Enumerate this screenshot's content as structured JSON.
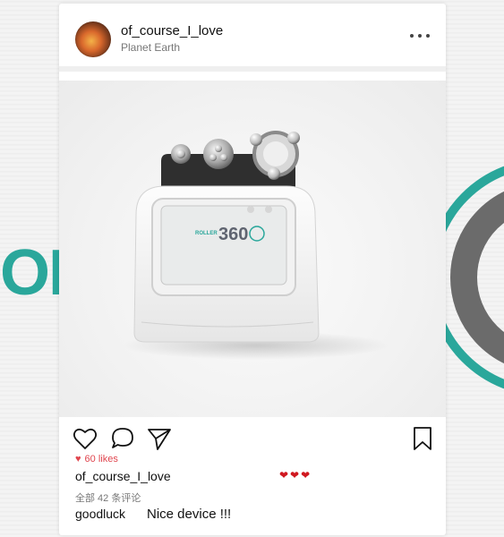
{
  "post": {
    "username": "of_course_I_love",
    "location": "Planet Earth",
    "likes": "60 likes",
    "caption_user": "of_course_I_love",
    "caption_hearts": "❤❤❤",
    "comments_count": "全部 42 条评论",
    "comment": {
      "user": "goodluck",
      "text": "Nice device !!!"
    }
  },
  "photo": {
    "screen_logo_prefix": "ROLLER",
    "screen_logo_number": "360"
  },
  "background": {
    "brand_fragment": "OL"
  },
  "icons": {
    "like": "heart-icon",
    "comment": "comment-icon",
    "share": "send-icon",
    "save": "bookmark-icon",
    "more": "more-options-icon",
    "likes_heart": "small-heart-icon"
  },
  "colors": {
    "accent_like": "#e0454e",
    "brand_teal": "#2aa79b"
  }
}
